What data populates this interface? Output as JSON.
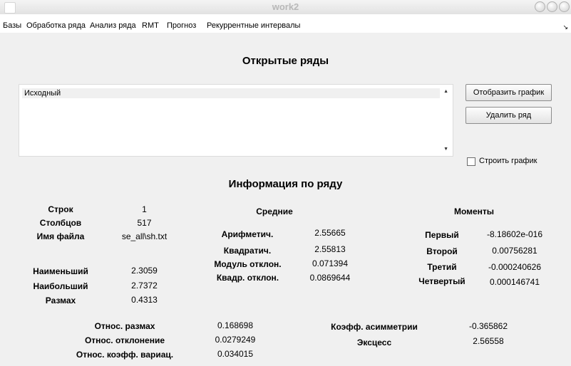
{
  "window": {
    "title": "work2"
  },
  "menu": [
    "Базы",
    "Обработка ряда",
    "Анализ ряда",
    "RMT",
    "Прогноз",
    "Рекуррентные интервалы"
  ],
  "open_series": {
    "heading": "Открытые ряды",
    "items": [
      "Исходный"
    ],
    "show_plot_button": "Отобразить график",
    "delete_button": "Удалить ряд",
    "build_plot_checkbox": {
      "label": "Строить график",
      "checked": false
    }
  },
  "info": {
    "heading": "Информация по ряду",
    "rows_label": "Строк",
    "rows_value": "1",
    "cols_label": "Столбцов",
    "cols_value": "517",
    "file_label": "Имя файла",
    "file_value": "se_all\\sh.txt",
    "min_label": "Наименьший",
    "min_value": "2.3059",
    "max_label": "Наибольший",
    "max_value": "2.7372",
    "range_label": "Размах",
    "range_value": "0.4313",
    "means": {
      "heading": "Средние",
      "arith_label": "Арифметич.",
      "arith_value": "2.55665",
      "quad_label": "Квадратич.",
      "quad_value": "2.55813",
      "mad_label": "Модуль отклон.",
      "mad_value": "0.071394",
      "rms_label": "Квадр. отклон.",
      "rms_value": "0.0869644"
    },
    "moments": {
      "heading": "Моменты",
      "first_label": "Первый",
      "first_value": "-8.18602e-016",
      "second_label": "Второй",
      "second_value": "0.00756281",
      "third_label": "Третий",
      "third_value": "-0.000240626",
      "fourth_label": "Четвертый",
      "fourth_value": "0.000146741"
    },
    "rel_range_label": "Относ. размах",
    "rel_range_value": "0.168698",
    "rel_dev_label": "Относ. отклонение",
    "rel_dev_value": "0.0279249",
    "rel_cv_label": "Относ. коэфф. вариац.",
    "rel_cv_value": "0.034015",
    "skew_label": "Коэфф. асимметрии",
    "skew_value": "-0.365862",
    "kurt_label": "Эксцесс",
    "kurt_value": "2.56558"
  }
}
